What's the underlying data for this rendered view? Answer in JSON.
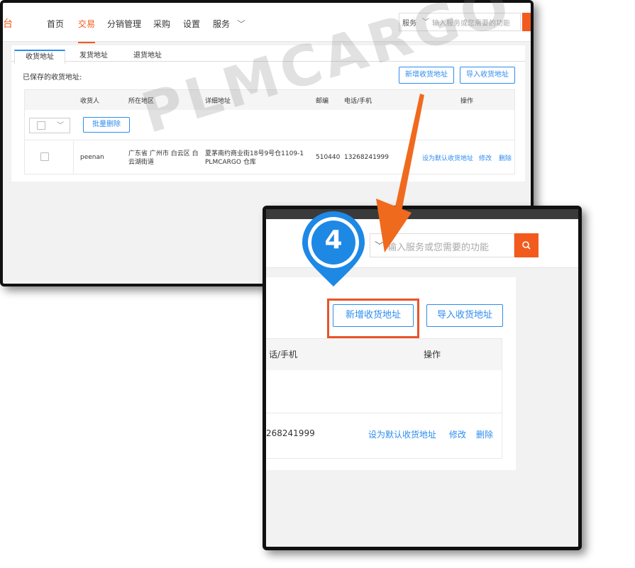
{
  "top_window": {
    "logo_fragment": "台",
    "nav": [
      "首页",
      "交易",
      "分销管理",
      "采购",
      "设置",
      "服务"
    ],
    "search_category": "服务",
    "search_placeholder": "输入服务或您需要的功能",
    "tabs": [
      "收货地址",
      "发货地址",
      "退货地址"
    ],
    "saved_label": "已保存的收货地址:",
    "btn_add": "新增收货地址",
    "btn_import": "导入收货地址",
    "headers": [
      "收货人",
      "所在地区",
      "详细地址",
      "邮编",
      "电话/手机",
      "操作"
    ],
    "batch_delete": "批量删除",
    "row": {
      "name": "peenan",
      "region": "广东省 广州市 白云区 白云湖街道",
      "address": "夏茅南约商业街18号9号仓1109-1 PLMCARGO 仓库",
      "postcode": "510440",
      "phone": "13268241999",
      "actions": [
        "设为默认收货地址",
        "修改",
        "删除"
      ]
    }
  },
  "watermark": "PLMCARGO",
  "zoom_window": {
    "step_number": "4",
    "search_placeholder": "输入服务或您需要的功能",
    "btn_add": "新增收货地址",
    "btn_import": "导入收货地址",
    "header_phone": "话/手机",
    "header_actions": "操作",
    "phone": "268241999",
    "actions": [
      "设为默认收货地址",
      "修改",
      "删除"
    ]
  },
  "colors": {
    "accent": "#f25a1e",
    "link": "#2d8cf0",
    "highlight": "#e8542a",
    "pin": "#1e88e5"
  }
}
